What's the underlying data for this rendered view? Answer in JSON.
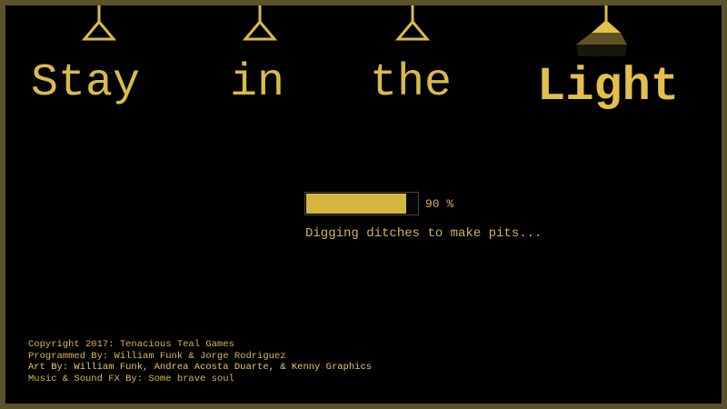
{
  "title": {
    "words": [
      "Stay",
      "in",
      "the",
      "Light"
    ]
  },
  "colors": {
    "gold": "#d9bb4c",
    "frame": "#5c5229",
    "background": "#000000"
  },
  "icons": [
    "ceiling-lamp-icon",
    "ceiling-lamp-icon",
    "ceiling-lamp-icon",
    "ceiling-lamp-lit-icon"
  ],
  "loading": {
    "progress": 0.9,
    "percent_label": "90 %",
    "message": "Digging ditches to make pits..."
  },
  "credits": [
    "Copyright 2017: Tenacious Teal Games",
    "Programmed By: William Funk & Jorge Rodriguez",
    "Art By: William Funk, Andrea Acosta Duarte, & Kenny Graphics",
    "Music & Sound FX By: Some brave soul"
  ]
}
